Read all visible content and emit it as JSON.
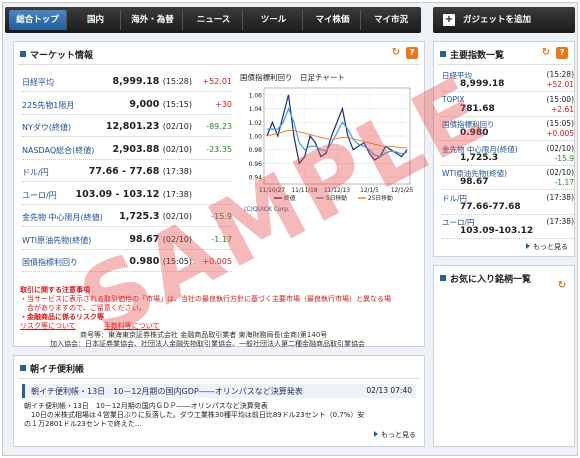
{
  "nav": {
    "items": [
      "総合トップ",
      "国内",
      "海外・為替",
      "ニュース",
      "ツール",
      "マイ株価",
      "マイ市況"
    ],
    "gadget_label": "ガジェットを追加"
  },
  "market": {
    "title": "マーケット情報",
    "rows": [
      {
        "name": "日経平均",
        "value": "8,999.18",
        "time": "(15:28)",
        "change": "+52.01",
        "dir": "up"
      },
      {
        "name": "225先物1限月",
        "value": "9,000",
        "time": "(15:15)",
        "change": "+30",
        "dir": "up"
      },
      {
        "name": "NYダウ(終値)",
        "value": "12,801.23",
        "time": "(02/10)",
        "change": "-89.23",
        "dir": "dn"
      },
      {
        "name": "NASDAQ総合(終値)",
        "value": "2,903.88",
        "time": "(02/10)",
        "change": "-23.35",
        "dir": "dn"
      },
      {
        "name": "ドル/円",
        "value": "77.66 - 77.68",
        "time": "(17:38)",
        "change": "",
        "dir": ""
      },
      {
        "name": "ユーロ/円",
        "value": "103.09 - 103.12",
        "time": "(17:38)",
        "change": "",
        "dir": ""
      },
      {
        "name": "金先物 中心限月(終値)",
        "value": "1,725.3",
        "time": "(02/10)",
        "change": "-15.9",
        "dir": "dn"
      },
      {
        "name": "WTI原油先物(終値)",
        "value": "98.67",
        "time": "(02/10)",
        "change": "-1.17",
        "dir": "dn"
      },
      {
        "name": "国債指標利回り",
        "value": "0.980",
        "time": "(15:05)",
        "change": "+0.005",
        "dir": "up"
      }
    ]
  },
  "chart_data": {
    "type": "line",
    "title": "国債指標利回り　日足チャート",
    "x_ticks": [
      "11/10/27",
      "11/11/18",
      "11/12/13",
      "12/1/5",
      "12/1/25"
    ],
    "y_ticks": [
      1.06,
      1.04,
      1.02,
      1.0,
      0.98,
      0.96,
      0.94
    ],
    "ylim": [
      0.93,
      1.07
    ],
    "legend": [
      "終値",
      "5日移動",
      "25日移動"
    ],
    "colors": {
      "close": "#1a2a8a",
      "ma5": "#3aa0e0",
      "ma25": "#e8791c"
    },
    "series": [
      {
        "name": "終値",
        "values": [
          1.0,
          1.02,
          1.0,
          1.03,
          1.06,
          1.0,
          0.96,
          0.97,
          1.0,
          0.99,
          0.97,
          0.975,
          1.0,
          1.02,
          1.04,
          1.0,
          0.98,
          0.985,
          0.99,
          0.975,
          0.965,
          0.97,
          0.985,
          0.98,
          0.975,
          0.97,
          0.98
        ]
      },
      {
        "name": "5日移動",
        "values": [
          1.01,
          1.01,
          1.01,
          1.02,
          1.04,
          1.02,
          0.99,
          0.98,
          0.985,
          0.985,
          0.98,
          0.978,
          0.99,
          1.005,
          1.02,
          1.01,
          0.995,
          0.988,
          0.985,
          0.98,
          0.972,
          0.97,
          0.975,
          0.978,
          0.977,
          0.974,
          0.976
        ]
      },
      {
        "name": "25日移動",
        "values": [
          1.0,
          1.002,
          1.004,
          1.006,
          1.008,
          1.008,
          1.006,
          1.004,
          1.002,
          1.0,
          0.998,
          0.996,
          0.995,
          0.996,
          0.998,
          0.998,
          0.996,
          0.994,
          0.992,
          0.99,
          0.988,
          0.986,
          0.985,
          0.985,
          0.984,
          0.983,
          0.983
        ]
      }
    ],
    "credit": "(C)QUICK Corp."
  },
  "notice": {
    "l1": "取引に関する注意事項",
    "l2": "・当サービスに表示される取引価格の「市場」は、当社の最良執行方針に基づく主要市場（最良執行市場）と異なる場",
    "l3": "　合がありますので、ご留意ください。",
    "l4": "・金融商品に係るリスク等",
    "l5a": "リスク等について",
    "l5b": "手数料等について",
    "l6": "商号等：東海東京証券株式会社 金融商品取引業者 東海財務局長(金商)第140号",
    "l7": "加入協会：日本証券業協会、社団法人金融先物取引業協会、一般社団法人第二種金融商品取引業協会"
  },
  "flash": {
    "title": "朝イチ便利帳",
    "headline": "朝イチ便利帳・13日　10－12月期の国内GDP――オリンパスなど決算発表",
    "date": "02/13 07:40",
    "body1": "朝イチ便利帳・13日　10－12月期の国内ＧＤＰ――オリンパスなど決算発表",
    "body2": "　10日の米株式相場は４営業日ぶりに反落した。ダウ工業株30種平均は前日比89ドル23セント（0.7%）安",
    "body3": "の１万2801ドル23セントで終えた…",
    "more": "もっと見る"
  },
  "indices": {
    "title": "主要指数一覧",
    "rows": [
      {
        "name": "日経平均",
        "time": "(15:28)",
        "value": "8,999.18",
        "change": "+52.01",
        "dir": "up"
      },
      {
        "name": "TOPIX",
        "time": "(15:00)",
        "value": "781.68",
        "change": "+2.61",
        "dir": "up"
      },
      {
        "name": "国債指標利回り",
        "time": "(15:05)",
        "value": "0.980",
        "change": "+0.005",
        "dir": "up"
      },
      {
        "name": "金先物 中心限月(終値)",
        "time": "(02/10)",
        "value": "1,725.3",
        "change": "-15.9",
        "dir": "dn"
      },
      {
        "name": "WTI原油先物(終値)",
        "time": "(02/10)",
        "value": "98.67",
        "change": "-1.17",
        "dir": "dn"
      },
      {
        "name": "ドル/円",
        "time": "(17:38)",
        "value": "77.66-77.68",
        "change": "",
        "dir": ""
      },
      {
        "name": "ユーロ/円",
        "time": "(17:38)",
        "value": "103.09-103.12",
        "change": "",
        "dir": ""
      }
    ],
    "more": "もっと見る"
  },
  "favorites": {
    "title": "お気に入り銘柄一覧"
  },
  "watermark": "SAMPLE"
}
